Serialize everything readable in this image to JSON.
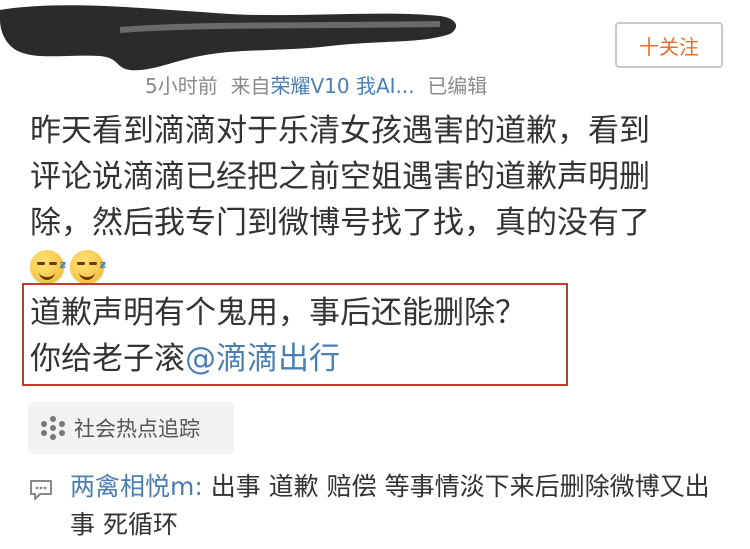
{
  "post": {
    "meta": {
      "time": "5小时前",
      "from": "来自",
      "device": "荣耀V10 我AI...",
      "edited": "已编辑"
    },
    "follow_label": "十关注",
    "body_lines": [
      "昨天看到滴滴对于乐清女孩遇害的道歉，看到",
      "评论说滴滴已经把之前空姐遇害的道歉声明删",
      "除，然后我专门到微博号找了找，真的没有了"
    ],
    "emoji_icons": [
      "sweat-smile-emoji",
      "sweat-smile-emoji"
    ],
    "highlight": {
      "line1": "道歉声明有个鬼用，事后还能删除？",
      "line2_prefix": "你给老子滚",
      "mention": "@滴滴出行"
    },
    "topic_chip": {
      "icon": "topic-icon",
      "label": "社会热点追踪"
    }
  },
  "comment": {
    "icon": "comment-icon",
    "author": "两禽相悦m:",
    "text": " 出事 道歉 赔偿 等事情淡下来后删除微博又出事 死循环"
  },
  "colors": {
    "link": "#4a7fb5",
    "follow": "#e8702a",
    "highlight_border": "#c23b2b",
    "meta": "#8a8a8a"
  }
}
